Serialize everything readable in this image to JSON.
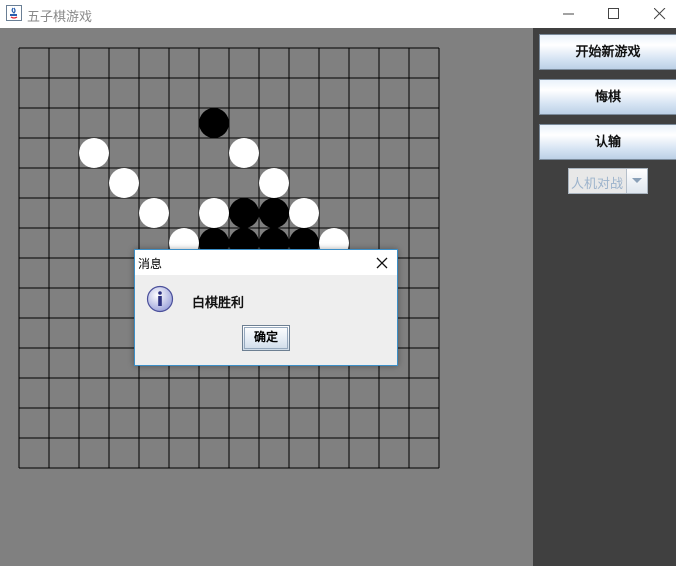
{
  "window": {
    "title": "五子棋游戏"
  },
  "sidebar": {
    "new_game": "开始新游戏",
    "undo": "悔棋",
    "surrender": "认输",
    "mode_selected": "人机对战"
  },
  "board": {
    "size": 15,
    "black": [
      [
        6,
        2
      ],
      [
        7,
        5
      ],
      [
        8,
        5
      ],
      [
        6,
        6
      ],
      [
        7,
        6
      ],
      [
        8,
        6
      ],
      [
        9,
        6
      ],
      [
        6,
        7
      ],
      [
        7,
        7
      ],
      [
        8,
        7
      ],
      [
        4,
        7
      ],
      [
        5,
        7
      ]
    ],
    "white": [
      [
        2,
        3
      ],
      [
        7,
        3
      ],
      [
        3,
        4
      ],
      [
        8,
        4
      ],
      [
        4,
        5
      ],
      [
        6,
        5
      ],
      [
        9,
        5
      ],
      [
        5,
        6
      ],
      [
        10,
        6
      ],
      [
        6,
        7
      ],
      [
        9,
        7
      ],
      [
        4,
        8
      ]
    ]
  },
  "dialog": {
    "title": "消息",
    "message": "白棋胜利",
    "ok": "确定",
    "icon": "info-icon"
  },
  "colors": {
    "board_bg": "#808080",
    "sidebar_bg": "#404040",
    "dialog_border": "#3c8fc7"
  }
}
